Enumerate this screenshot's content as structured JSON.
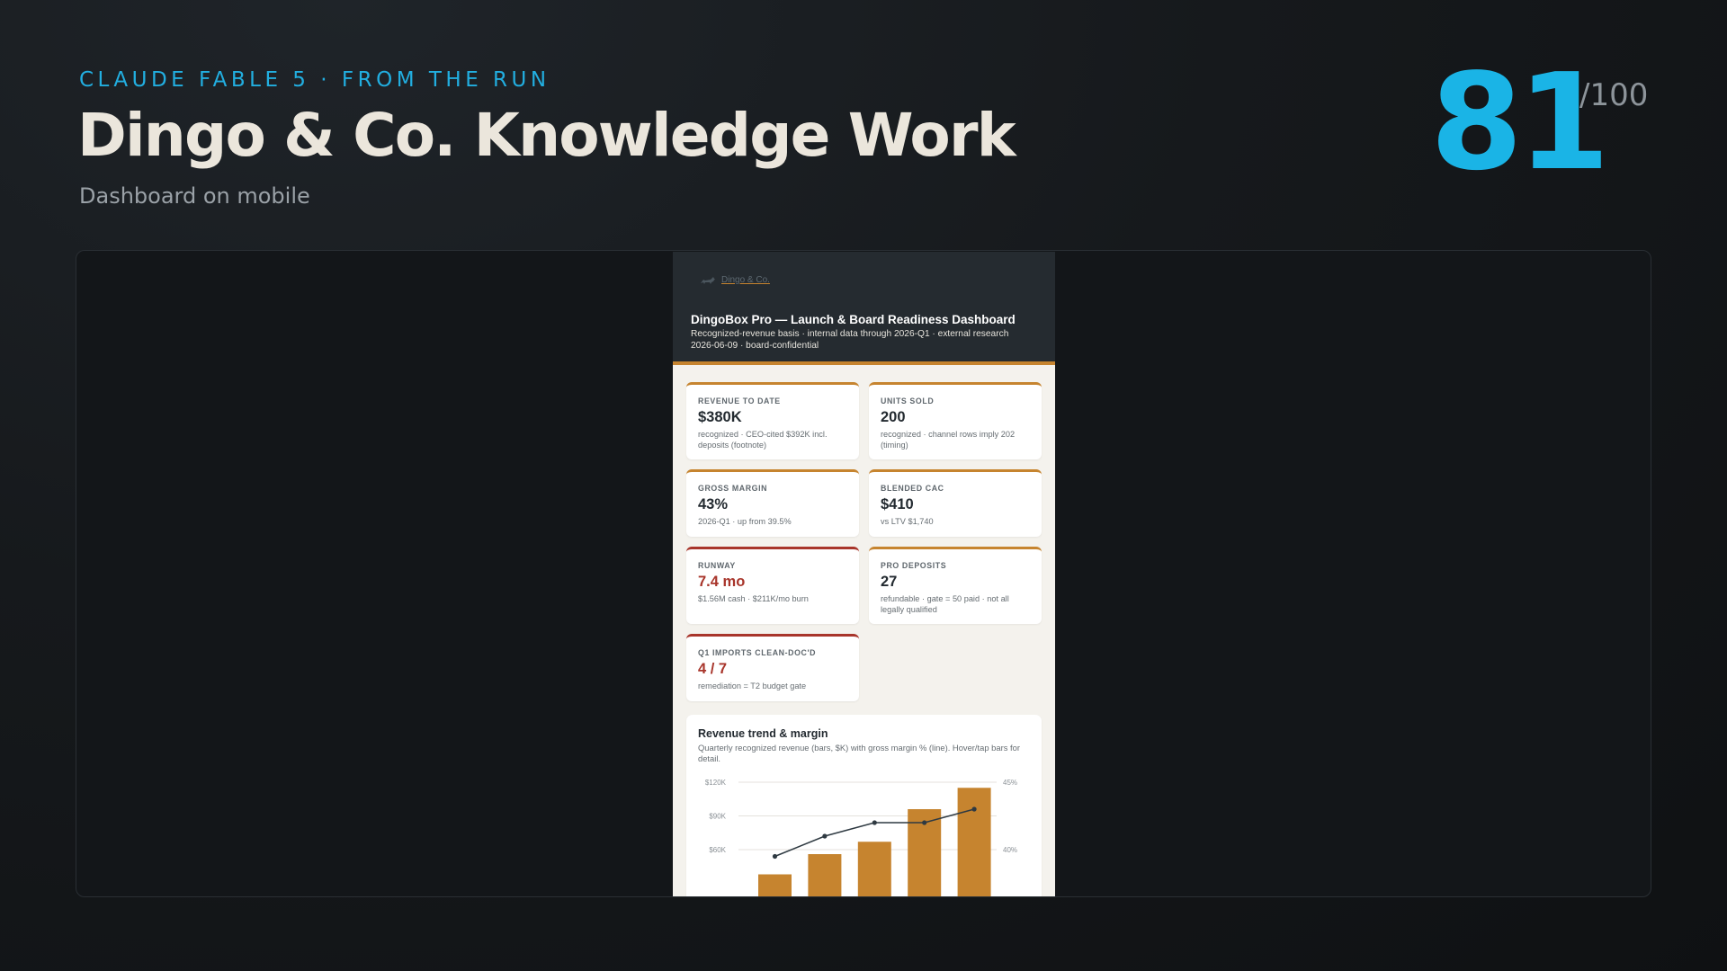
{
  "header": {
    "eyebrow": "CLAUDE FABLE 5 · FROM THE RUN",
    "title": "Dingo & Co. Knowledge Work",
    "subtitle": "Dashboard on mobile",
    "score": "81",
    "score_max": "/100"
  },
  "dashboard": {
    "brand": "Dingo & Co.",
    "title": "DingoBox Pro — Launch & Board Readiness Dashboard",
    "subtitle": "Recognized-revenue basis · internal data through 2026-Q1 · external research 2026-06-09 · board-confidential",
    "cards": [
      {
        "label": "REVENUE TO DATE",
        "value": "$380K",
        "note": "recognized · CEO-cited $392K incl. deposits (footnote)"
      },
      {
        "label": "UNITS SOLD",
        "value": "200",
        "note": "recognized · channel rows imply 202 (timing)"
      },
      {
        "label": "GROSS MARGIN",
        "value": "43%",
        "note": "2026-Q1 · up from 39.5%"
      },
      {
        "label": "BLENDED CAC",
        "value": "$410",
        "note": "vs LTV $1,740"
      },
      {
        "label": "RUNWAY",
        "value": "7.4 mo",
        "note": "$1.56M cash · $211K/mo burn"
      },
      {
        "label": "PRO DEPOSITS",
        "value": "27",
        "note": "refundable · gate = 50 paid · not all legally qualified"
      },
      {
        "label": "Q1 IMPORTS CLEAN-DOC'D",
        "value": "4 / 7",
        "note": "remediation = T2 budget gate"
      }
    ],
    "colors": {
      "accent": "#c6842f",
      "alert": "#a8352b",
      "header_bg": "#252b30"
    }
  },
  "chart_data": {
    "type": "bar",
    "title": "Revenue trend & margin",
    "description": "Quarterly recognized revenue (bars, $K) with gross margin % (line). Hover/tap bars for detail.",
    "y_tick_labels": [
      "$120K",
      "$90K",
      "$60K"
    ],
    "y2_tick_labels": [
      "45%",
      "40%"
    ],
    "ylim": [
      0,
      120
    ],
    "y2lim": [
      35,
      45
    ],
    "series": [
      {
        "values": [
          38,
          56,
          67,
          96,
          115
        ]
      },
      {
        "values": [
          39.5,
          41,
          42,
          42,
          43
        ]
      }
    ],
    "grid": true
  }
}
